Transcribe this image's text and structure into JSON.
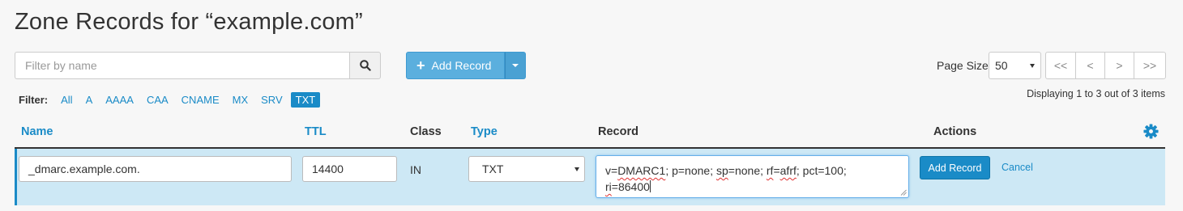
{
  "page": {
    "title": "Zone Records for “example.com”"
  },
  "search": {
    "placeholder": "Filter by name",
    "icon": "search-icon"
  },
  "add_record": {
    "label": "Add Record",
    "icon": "plus-icon"
  },
  "filter": {
    "label": "Filter:",
    "options": [
      "All",
      "A",
      "AAAA",
      "CAA",
      "CNAME",
      "MX",
      "SRV",
      "TXT"
    ],
    "active": "TXT"
  },
  "pager": {
    "page_size_label": "Page Size",
    "page_size": "50",
    "buttons": [
      "<<",
      "<",
      ">",
      ">>"
    ],
    "displaying": "Displaying 1 to 3 out of 3 items"
  },
  "table": {
    "headers": {
      "name": "Name",
      "ttl": "TTL",
      "class": "Class",
      "type": "Type",
      "record": "Record",
      "actions": "Actions"
    },
    "settings_icon": "gear-icon"
  },
  "edit_row": {
    "name": "_dmarc.example.com.",
    "ttl": "14400",
    "class": "IN",
    "type": "TXT",
    "record_parts": [
      "v=",
      "DMARC1",
      "; p=none; ",
      "sp",
      "=none; ",
      "rf",
      "=",
      "afrf",
      "; pct=100;",
      "ri",
      "=86400"
    ],
    "save_label": "Add Record",
    "cancel_label": "Cancel"
  },
  "colors": {
    "accent": "#1a8bc7",
    "add_button": "#5bafde",
    "edit_row_bg": "#cde8f5"
  }
}
